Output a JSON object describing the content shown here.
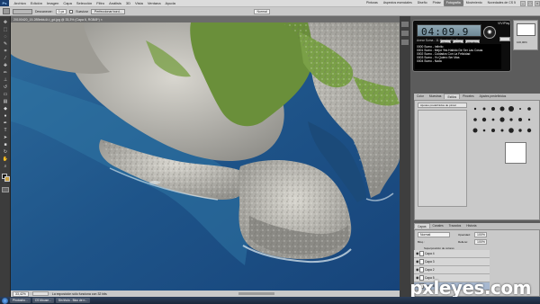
{
  "menubar": {
    "logo": "Ps",
    "items": [
      "Archivo",
      "Edición",
      "Imagen",
      "Capa",
      "Selección",
      "Filtro",
      "Análisis",
      "3D",
      "Vista",
      "Ventana",
      "Ayuda"
    ],
    "workspaces": [
      "Pinturas",
      "Aspectos esenciales",
      "Diseño",
      "Pintar",
      "Fotografía",
      "Movimiento",
      "Novedades de CS 5"
    ],
    "active_workspace": "Fotografía",
    "minimize": "–",
    "restore": "□",
    "close": "×"
  },
  "options": {
    "feather_label": "Desvanecer:",
    "feather_value": "0 px",
    "antialias_label": "Suavizar",
    "refine_button": "Perfeccionar bord...",
    "style_value": "Normal"
  },
  "document": {
    "tab_title": "20100420_15-28Beldu1t-t_gd.jpg @ 33,3% (Capa 6, RGB/8*)  ×",
    "zoom": "33,42%",
    "status_text": "La exposición sólo funciona con 32 bits"
  },
  "clock_widget": {
    "brand": "VIVIPlay",
    "time": "04:09.9",
    "track_info": "Anear    Suma - 11 Happier Ver.3",
    "track_list": [
      "0000 Sumo - Infinito",
      "0001 Sumo - Mejor Yes Habido De Ser Las Cosas",
      "0002 Sumo - Cuidados Con La Felicidad",
      "0003 Sumo - Yo Quiero Ser Mas",
      "0004 Sumo - Nada"
    ],
    "buttons": [
      "Open",
      "Loop",
      "Random"
    ],
    "knob": "◉"
  },
  "right_panels": {
    "zoom_readout": "100,00%",
    "tabs_top": [
      "Color",
      "Muestras",
      "Estilos",
      "Pinceles",
      "Ajustes predefinidos"
    ],
    "active_tab_top": "Estilos",
    "preset_label": "Ajustes predefinidos de pincel",
    "layers_tabs": [
      "Capas",
      "Canales",
      "Trazados",
      "Historia"
    ],
    "blend_mode": "Normal",
    "opacity_label": "Opacidad:",
    "opacity_value": "100%",
    "lock_label": "Bloq.:",
    "fill_label": "Relleno:",
    "fill_value": "100%",
    "layers": [
      "Capa 4",
      "Capa 3",
      "Capa 2",
      "Capa 5",
      "Capa 6"
    ],
    "group_label": "Superposición de colores"
  },
  "taskbar": {
    "items": [
      "Photosho...",
      "CS Mouse...",
      "Sin título - Bloc de n..."
    ]
  },
  "watermark": "pxleyes.com",
  "colors": {
    "sea_deep": "#1d4d8a",
    "sea_shallow": "#2f6c9e",
    "rock": "#c4c2bb",
    "grass": "#6a8f3a",
    "workspace_bg": "#535353"
  }
}
